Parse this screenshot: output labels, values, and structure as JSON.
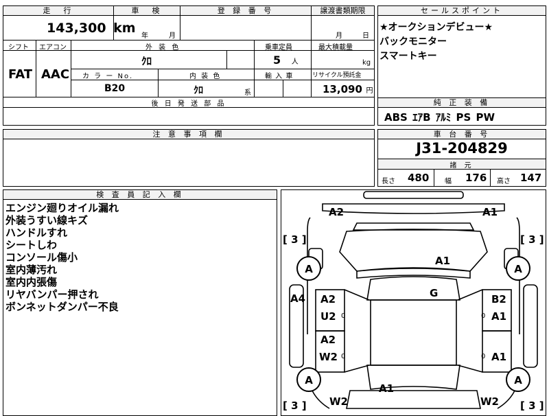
{
  "top_labels": {
    "mileage": "走　行",
    "inspection": "車　検",
    "registration": "登 録 番 号",
    "transfer_deadline": "譲渡書類期限",
    "sales_point": "セールスポイント"
  },
  "mileage": {
    "value": "143,300",
    "unit": "km"
  },
  "inspection_date": {
    "year": "年",
    "month": "月"
  },
  "transfer_date": {
    "month": "月",
    "day": "日"
  },
  "row2_labels": {
    "shift": "シフト",
    "aircon": "エアコン",
    "exterior_color": "外 装 色",
    "capacity": "乗車定員",
    "max_load": "最大積載量"
  },
  "shift": "FAT",
  "aircon": "AAC",
  "exterior_color": "ｸﾛ",
  "capacity": {
    "value": "5",
    "unit": "人"
  },
  "max_load": {
    "unit": "kg"
  },
  "row3_labels": {
    "color_no": "カ ラ ー No.",
    "interior_color": "内 装 色",
    "import": "輸 入 車",
    "recycle": "リサイクル預託金"
  },
  "color_no": "B20",
  "interior_color": {
    "value": "ｸﾛ",
    "suffix": "系"
  },
  "recycle": {
    "value": "13,090",
    "unit": "円"
  },
  "later_parts_label": "後 日 発 送 部 品",
  "sales_points": [
    "★オークションデビュー★",
    "バックモニター",
    "スマートキー"
  ],
  "genuine_label": "純 正 装 備",
  "genuine_equipment": "ABS ｴｱB ｱﾙﾐ PS PW",
  "caution_label": "注 意 事 項 欄",
  "chassis_label": "車 台 番 号",
  "chassis_number": "J31-204829",
  "specs_label": "諸 元",
  "specs": {
    "length_label": "長さ",
    "length": "480",
    "width_label": "幅",
    "width": "176",
    "height_label": "高さ",
    "height": "147"
  },
  "inspector_label": "検 査 員 記 入 欄",
  "inspector_notes": [
    "エンジン廻りオイル漏れ",
    "外装うすい線キズ",
    "ハンドルすれ",
    "シートしわ",
    "コンソール傷小",
    "室内薄汚れ",
    "室内内張傷",
    "リヤバンパー押され",
    "ボンネットダンパー不良"
  ],
  "diagram": {
    "marks": {
      "front_left": "A2",
      "front_right": "A1",
      "hood": "A1",
      "roof": "G",
      "left_front_door": "A2",
      "left_front_door2": "U2",
      "left_rear_door": "A2",
      "left_rear_door2": "W2",
      "left_side": "A4",
      "right_front_door": "B2",
      "right_front_door2": "A1",
      "right_rear_door": "A1",
      "trunk": "A1",
      "rear_left": "W2",
      "rear_right": "W2"
    },
    "tires": {
      "fl": "A",
      "fr": "A",
      "rl": "A",
      "rr": "A"
    },
    "tread": {
      "fl": "[ 3 ]",
      "fr": "[ 3 ]",
      "rl": "[ 3 ]",
      "rr": "[ 3 ]"
    },
    "door_glyph": "0"
  }
}
